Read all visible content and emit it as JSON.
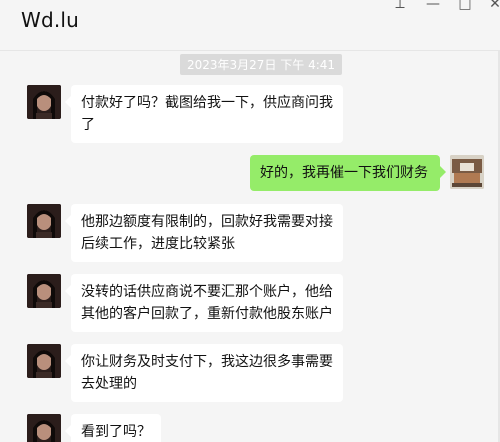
{
  "window": {
    "title": "Wd.lu"
  },
  "controls": {
    "pin": "⟂",
    "minimize": "—",
    "maximize": "□",
    "close": "✕"
  },
  "chat": {
    "timestamp": "2023年3月27日 下午 4:41",
    "messages": [
      {
        "side": "in",
        "text": "付款好了吗？截图给我一下，供应商问我了"
      },
      {
        "side": "out",
        "text": "好的，我再催一下我们财务"
      },
      {
        "side": "in",
        "text": "他那边额度有限制的，回款好我需要对接后续工作，进度比较紧张"
      },
      {
        "side": "in",
        "text": "没转的话供应商说不要汇那个账户，他给其他的客户回款了，重新付款他股东账户"
      },
      {
        "side": "in",
        "text": "你让财务及时支付下，我这边很多事需要去处理的"
      },
      {
        "side": "in",
        "text": "看到了吗？"
      }
    ]
  },
  "colors": {
    "incoming_bubble": "#ffffff",
    "outgoing_bubble": "#95ec69",
    "background": "#f5f5f5"
  }
}
